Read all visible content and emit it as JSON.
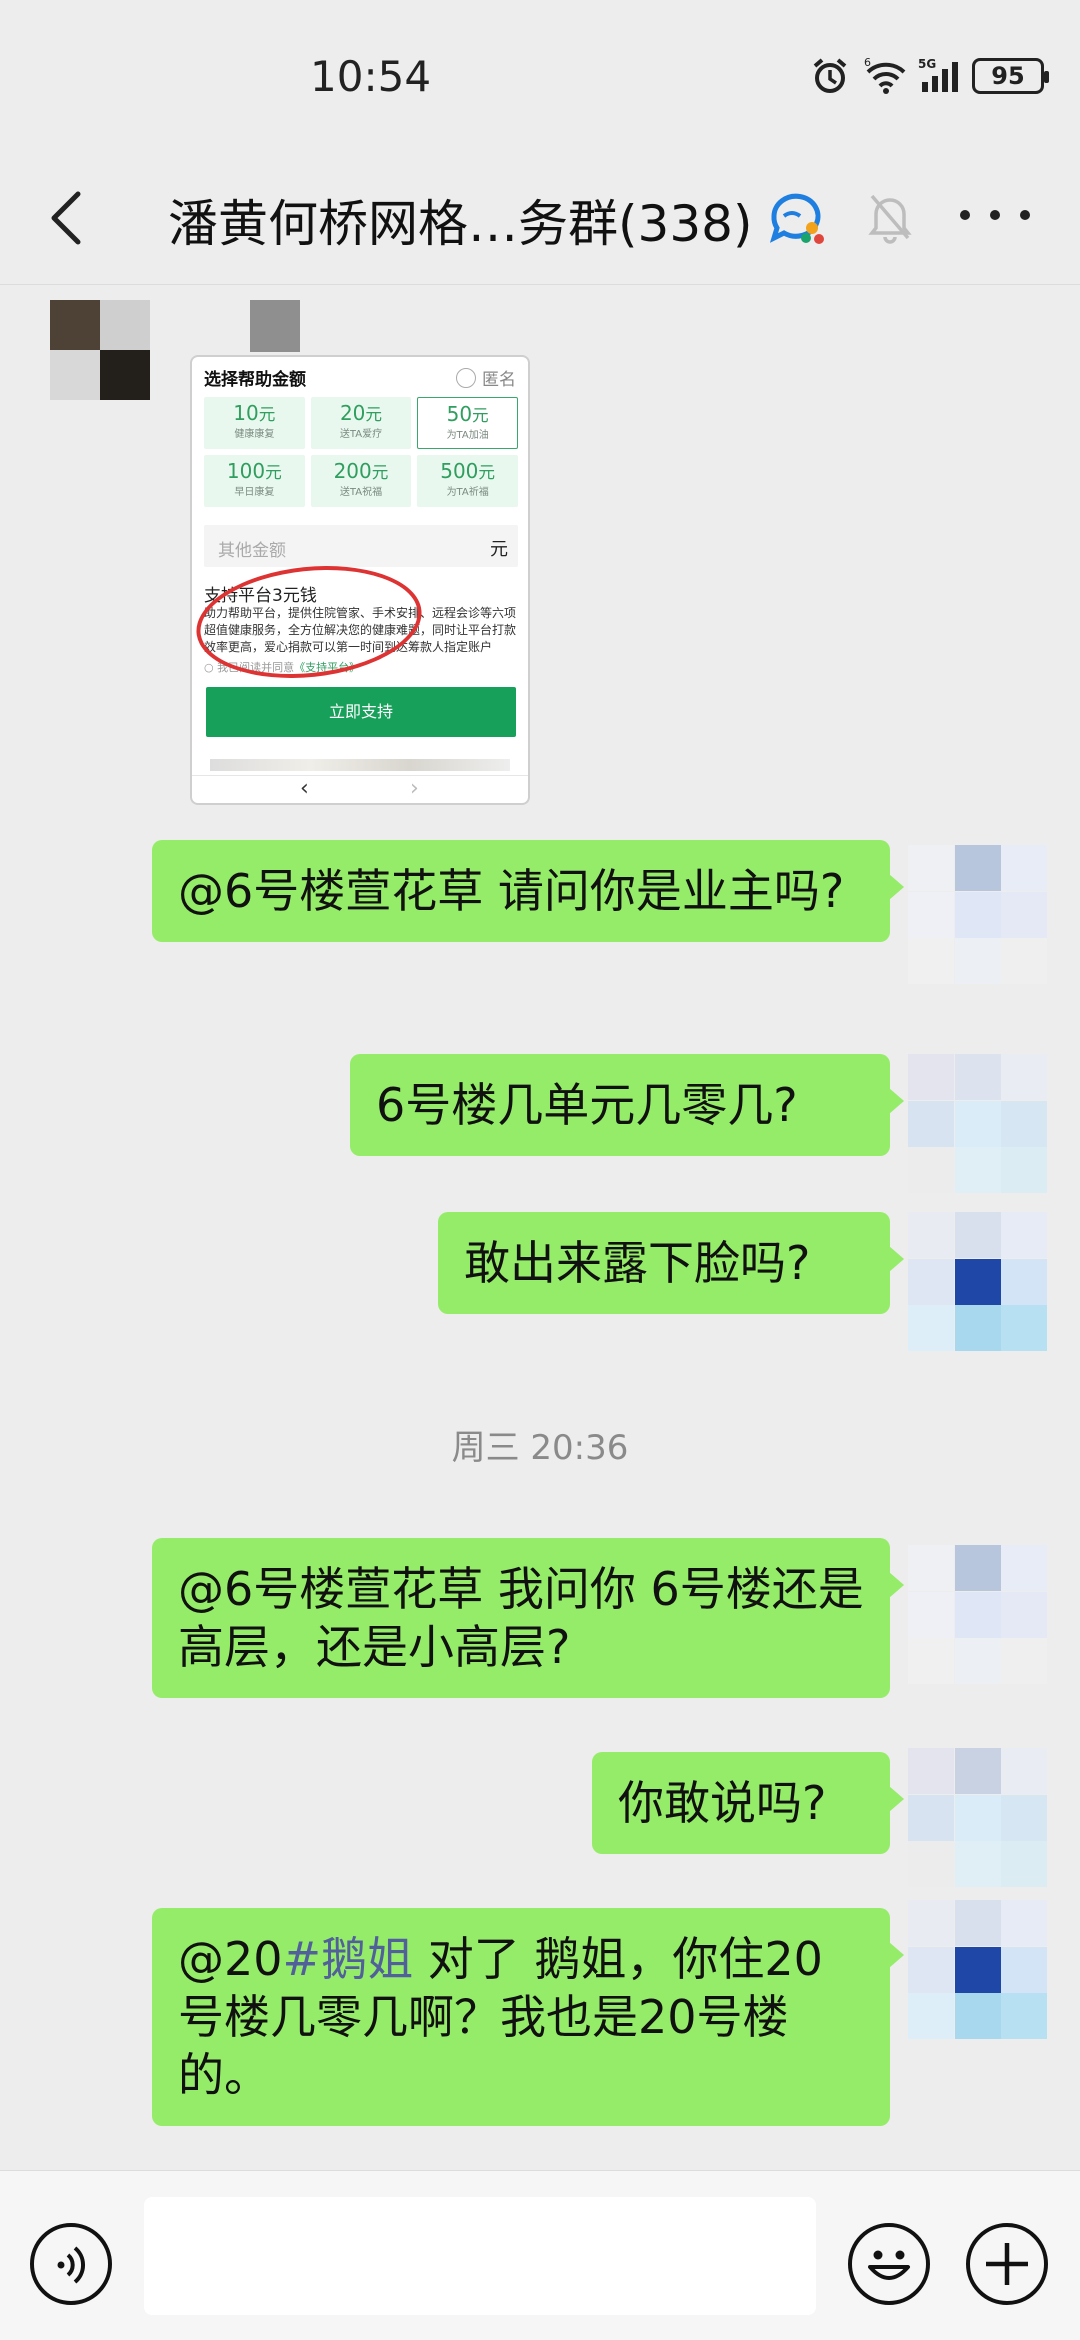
{
  "status_bar": {
    "time": "10:54",
    "network": "5G",
    "wifi_badge": "6",
    "battery": "95"
  },
  "header": {
    "title": "潘黄何桥网格…务群(338)",
    "icons": [
      "back-arrow-icon",
      "group-chat-icon",
      "mute-bell-icon",
      "more-dots-icon"
    ]
  },
  "image_message": {
    "title": "选择帮助金额",
    "anonymous_label": "匿名",
    "amounts": [
      {
        "value": "10",
        "unit": "元",
        "sub": "健康康复"
      },
      {
        "value": "20",
        "unit": "元",
        "sub": "送TA爱疗"
      },
      {
        "value": "50",
        "unit": "元",
        "sub": "为TA加油"
      },
      {
        "value": "100",
        "unit": "元",
        "sub": "早日康复"
      },
      {
        "value": "200",
        "unit": "元",
        "sub": "送TA祝福"
      },
      {
        "value": "500",
        "unit": "元",
        "sub": "为TA祈福"
      }
    ],
    "other_amount_placeholder": "其他金额",
    "other_amount_unit": "元",
    "support_title": "支持平台3元钱",
    "support_desc": "助力帮助平台，提供住院管家、手术安排、远程会诊等六项超值健康服务，全方位解决您的健康难题，同时让平台打款效率更高，爱心捐款可以第一时间到达筹款人指定账户",
    "agree_text": "我已阅读并同意",
    "agree_link": "《支持平台》",
    "support_button": "立即支持"
  },
  "messages": [
    {
      "pre": "@6号楼萱花草  请问你是业主吗?",
      "tag": "",
      "post": ""
    },
    {
      "pre": "6号楼几单元几零几?",
      "tag": "",
      "post": ""
    },
    {
      "pre": "敢出来露下脸吗?",
      "tag": "",
      "post": ""
    },
    {
      "pre": "@6号楼萱花草  我问你 6号楼还是高层，还是小高层?",
      "tag": "",
      "post": ""
    },
    {
      "pre": "你敢说吗?",
      "tag": "",
      "post": ""
    },
    {
      "pre": "@20",
      "tag": "#鹅姐",
      "post": "  对了 鹅姐，你住20号楼几零几啊？我也是20号楼的。"
    }
  ],
  "time_separator": "周三 20:36",
  "input_bar": {
    "icons": [
      "voice-icon",
      "emoji-icon",
      "plus-icon"
    ],
    "placeholder": ""
  },
  "colors": {
    "bubble_green": "#95ec69",
    "background": "#ededed",
    "tag_blue": "#51609a",
    "button_green": "#17a05a"
  }
}
